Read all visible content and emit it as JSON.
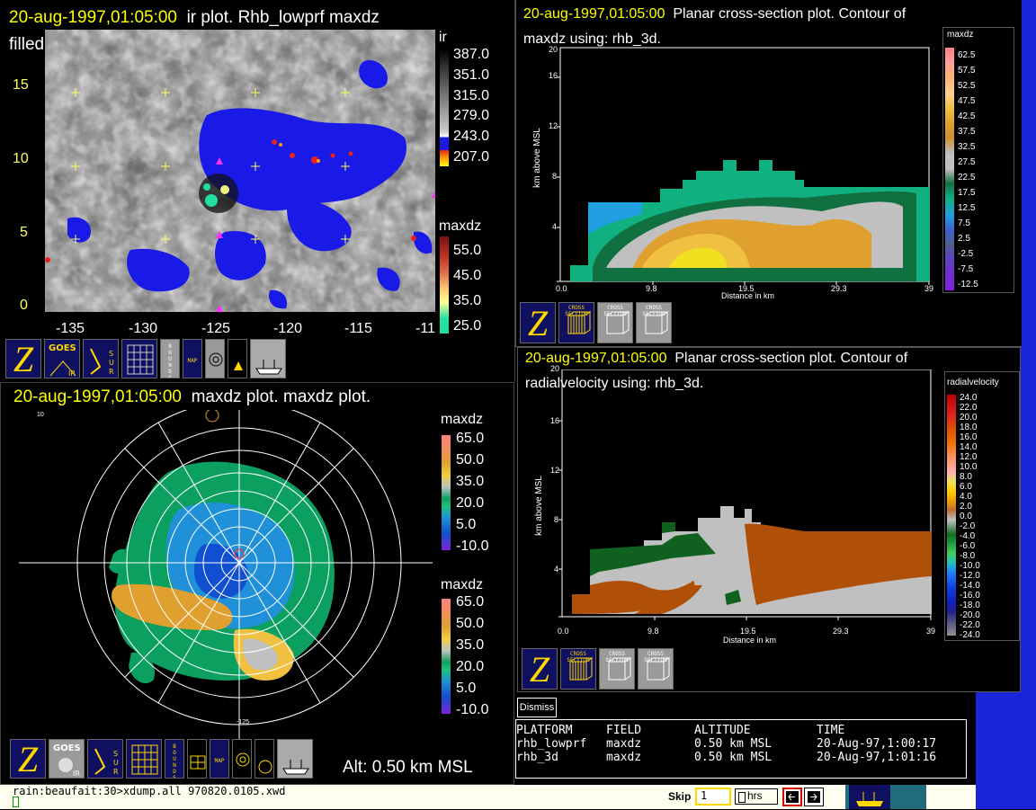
{
  "ir_window": {
    "title_time": "20-aug-1997,01:05:00",
    "title_text": "ir plot.  Rhb_lowprf maxdz",
    "title_line2": "filled contour.",
    "y_labels": [
      "15",
      "10",
      "5",
      "0"
    ],
    "x_labels": [
      "-135",
      "-130",
      "-125",
      "-120",
      "-115",
      "-11"
    ],
    "legend_ir_title": "ir",
    "legend_ir_values": [
      "387.0",
      "351.0",
      "315.0",
      "279.0",
      "243.0",
      "207.0"
    ],
    "legend_maxdz_title": "maxdz",
    "legend_maxdz_values": [
      "55.0",
      "45.0",
      "35.0",
      "25.0"
    ],
    "toolbar": [
      "Z",
      "GOES IR",
      "SUR",
      "grid",
      "BOUNDS",
      "MAP",
      "rings",
      "platform",
      "ship"
    ]
  },
  "cs_window_1": {
    "title_time": "20-aug-1997,01:05:00",
    "title_text": "Planar cross-section plot.  Contour of",
    "title_line2": "maxdz using: rhb_3d.",
    "ylabel": "km above MSL",
    "xlabel": "Distance in km",
    "y_ticks": [
      "16",
      "12",
      "8",
      "4",
      "0"
    ],
    "x_ticks": [
      "0.0",
      "9.8",
      "19.5",
      "29.3",
      "39"
    ],
    "y_top": "20",
    "legend_title": "maxdz",
    "legend_values": [
      "62.5",
      "57.5",
      "52.5",
      "47.5",
      "42.5",
      "37.5",
      "32.5",
      "27.5",
      "22.5",
      "17.5",
      "12.5",
      "7.5",
      "2.5",
      "-2.5",
      "-7.5",
      "-12.5"
    ],
    "toolbar_labels": [
      "CROSS SECTION",
      "CROSS SECTION",
      "CROSS SECTION"
    ]
  },
  "cs_window_2": {
    "title_time": "20-aug-1997,01:05:00",
    "title_text": "Planar cross-section plot.  Contour of",
    "title_line2": "radialvelocity using: rhb_3d.",
    "ylabel": "km above MSL",
    "xlabel": "Distance in km",
    "y_ticks": [
      "16",
      "12",
      "8",
      "4",
      "0"
    ],
    "x_ticks": [
      "0.0",
      "9.8",
      "19.5",
      "29.3",
      "39"
    ],
    "y_top": "20",
    "legend_title": "radialvelocity",
    "legend_values": [
      "24.0",
      "22.0",
      "20.0",
      "18.0",
      "16.0",
      "14.0",
      "12.0",
      "10.0",
      "8.0",
      "6.0",
      "4.0",
      "2.0",
      "0.0",
      "-2.0",
      "-4.0",
      "-6.0",
      "-8.0",
      "-10.0",
      "-12.0",
      "-14.0",
      "-16.0",
      "-18.0",
      "-20.0",
      "-22.0",
      "-24.0"
    ],
    "toolbar_labels": [
      "CROSS SECTION",
      "CROSS SECTION",
      "CROSS SECTION"
    ]
  },
  "maxdz_window": {
    "title_time": "20-aug-1997,01:05:00",
    "title_text": "maxdz plot.  maxdz plot.",
    "legend_title": "maxdz",
    "legend_values": [
      "65.0",
      "50.0",
      "35.0",
      "20.0",
      "5.0",
      "-10.0"
    ],
    "legend2_title": "maxdz",
    "legend2_values": [
      "65.0",
      "50.0",
      "35.0",
      "20.0",
      "5.0",
      "-10.0"
    ],
    "alt_text": "Alt: 0.50 km MSL",
    "tick_top": "10",
    "tick_bottom": "-125"
  },
  "dismiss_button": "Dismiss",
  "platform_table": {
    "headers": [
      "PLATFORM",
      "FIELD",
      "ALTITUDE",
      "TIME"
    ],
    "rows": [
      [
        "rhb_lowprf",
        "maxdz",
        "0.50 km MSL",
        "20-Aug-97,1:00:17"
      ],
      [
        "rhb_3d",
        "maxdz",
        "0.50 km MSL",
        "20-Aug-97,1:01:16"
      ]
    ]
  },
  "terminal": {
    "line": "rain:beaufait:30>xdump.all 970820.0105.xwd"
  },
  "skip_bar": {
    "label": "Skip",
    "value": "1",
    "unit": "hrs"
  },
  "colors": {
    "title": "#ffff00",
    "background": "#000000",
    "desktop": "#1a24d8"
  }
}
